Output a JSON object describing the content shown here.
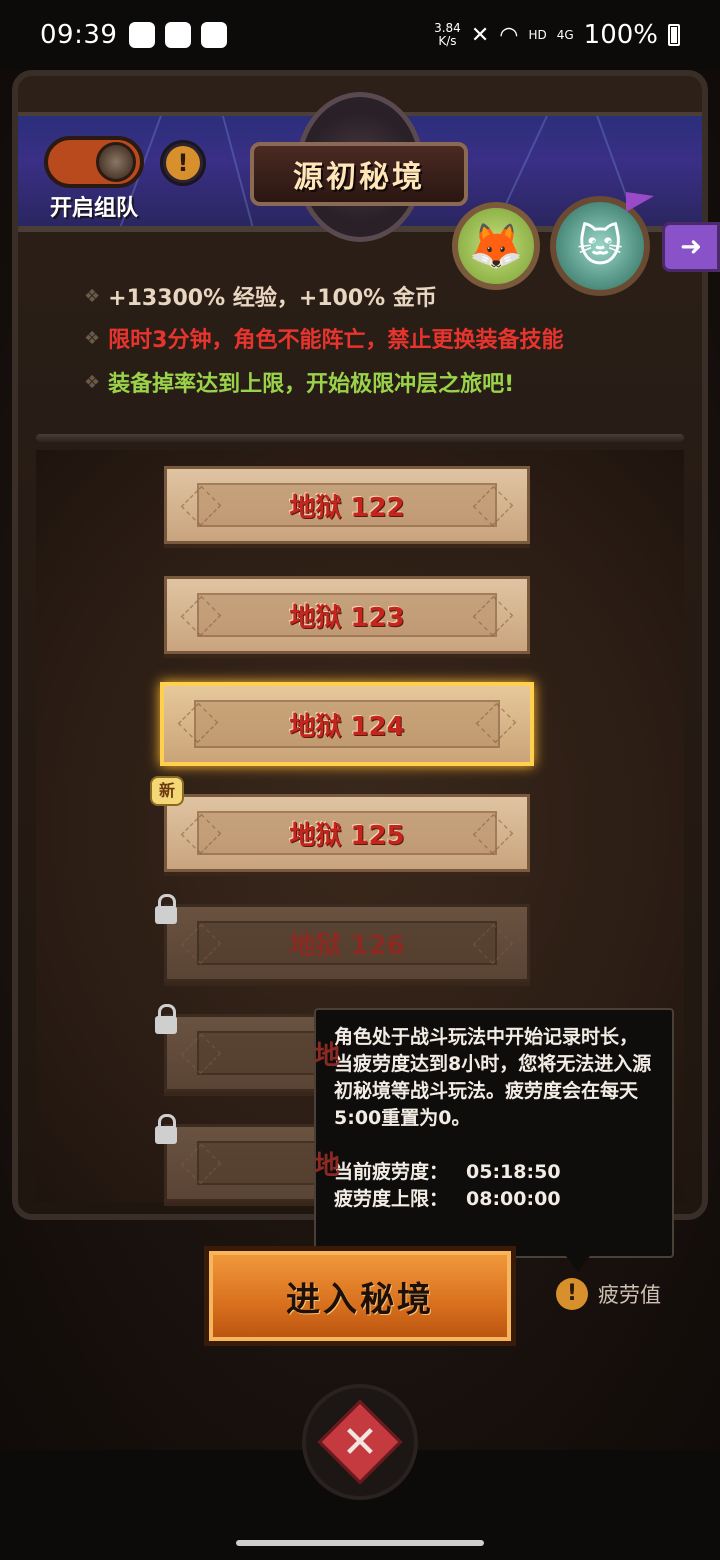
{
  "status_bar": {
    "time": "09:39",
    "speed_value": "3.84",
    "speed_unit": "K/s",
    "network_hd": "HD",
    "network_4g": "4G",
    "battery": "100%"
  },
  "header": {
    "team_toggle_label": "开启组队",
    "title": "源初秘境"
  },
  "info": {
    "line1": "+13300% 经验，+100% 金币",
    "line2": "限时3分钟，角色不能阵亡，禁止更换装备技能",
    "line3": "装备掉率达到上限，开始极限冲层之旅吧!",
    "colors": {
      "line1": "#e8d6c0",
      "line2": "#e8342e",
      "line3": "#9ad24a"
    }
  },
  "levels": [
    {
      "label": "地狱 122",
      "state": "unlocked"
    },
    {
      "label": "地狱 123",
      "state": "unlocked"
    },
    {
      "label": "地狱 124",
      "state": "selected"
    },
    {
      "label": "地狱 125",
      "state": "new"
    },
    {
      "label": "地狱 126",
      "state": "locked"
    },
    {
      "label": "地",
      "state": "locked"
    },
    {
      "label": "地",
      "state": "locked"
    }
  ],
  "new_badge": "新",
  "tooltip": {
    "description": "角色处于战斗玩法中开始记录时长，当疲劳度达到8小时，您将无法进入源初秘境等战斗玩法。疲劳度会在每天5:00重置为0。",
    "current_label": "当前疲劳度：",
    "current_value": "05:18:50",
    "limit_label": "疲劳度上限：",
    "limit_value": "08:00:00"
  },
  "enter_button": "进入秘境",
  "fatigue_label": "疲劳值",
  "icons": {
    "warning": "warning-icon",
    "lock": "lock-icon",
    "exit": "exit-icon",
    "close": "close-icon"
  }
}
